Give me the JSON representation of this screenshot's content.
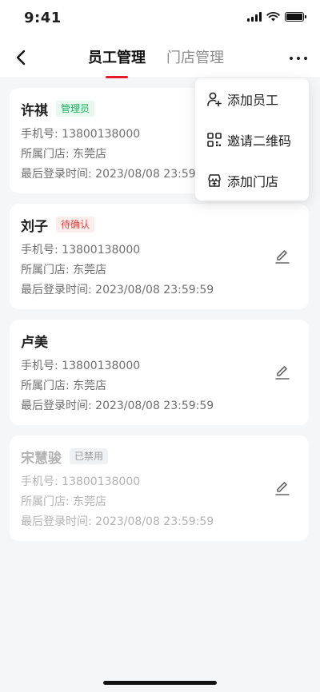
{
  "status_bar": {
    "time": "9:41"
  },
  "header": {
    "tabs": [
      {
        "label": "员工管理",
        "active": true
      },
      {
        "label": "门店管理",
        "active": false
      }
    ]
  },
  "menu": {
    "items": [
      {
        "label": "添加员工",
        "icon": "add-user-icon"
      },
      {
        "label": "邀请二维码",
        "icon": "qrcode-icon"
      },
      {
        "label": "添加门店",
        "icon": "add-store-icon"
      }
    ]
  },
  "employees": [
    {
      "name": "许祺",
      "badge": "管理员",
      "badge_color": "#13b25e",
      "phone": "手机号: 13800138000",
      "store": "所属门店: 东莞店",
      "last_login": "最后登录时间: 2023/08/08 23:59:59"
    },
    {
      "name": "刘子",
      "badge": "待确认",
      "badge_color": "#e5413b",
      "phone": "手机号: 13800138000",
      "store": "所属门店: 东莞店",
      "last_login": "最后登录时间: 2023/08/08 23:59:59"
    },
    {
      "name": "卢美",
      "badge": "",
      "phone": "手机号: 13800138000",
      "store": "所属门店: 东莞店",
      "last_login": "最后登录时间: 2023/08/08 23:59:59"
    },
    {
      "name": "宋慧骏",
      "badge": "已禁用",
      "badge_color": "#9a9a9a",
      "phone": "手机号: 13800138000",
      "store": "所属门店: 东莞店",
      "last_login": "最后登录时间: 2023/08/08 23:59:59"
    }
  ],
  "colors": {
    "accent": "#e51a2a",
    "background": "#f5f6f8"
  }
}
